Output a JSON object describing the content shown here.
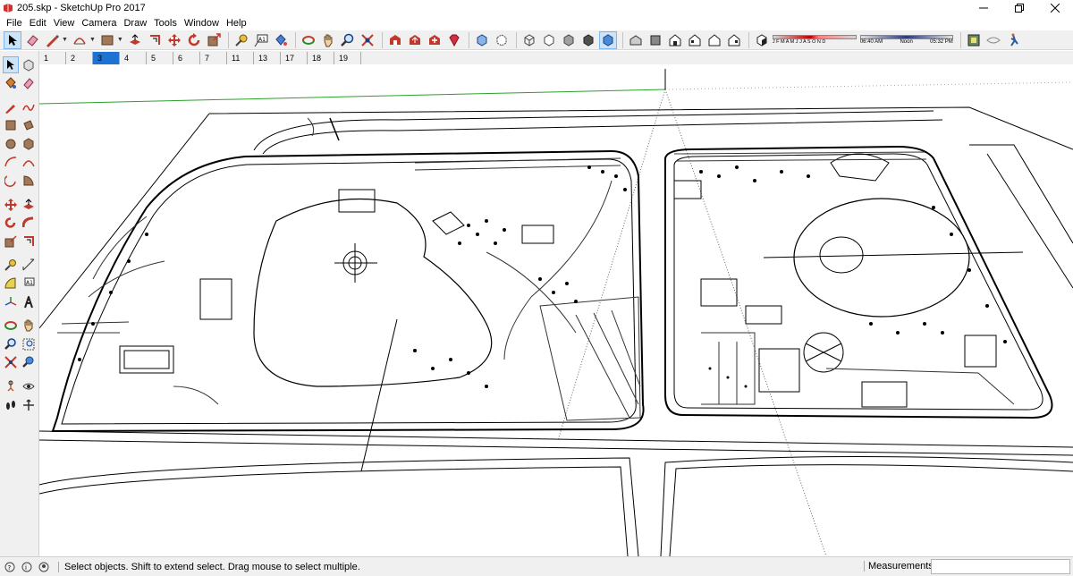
{
  "window": {
    "title": "205.skp - SketchUp Pro 2017",
    "controls": [
      "minimize",
      "maximize",
      "close"
    ]
  },
  "menu": [
    "File",
    "Edit",
    "View",
    "Camera",
    "Draw",
    "Tools",
    "Window",
    "Help"
  ],
  "shadow_settings": {
    "months": "J F M A M J J A S O N D",
    "time_start": "06:40 AM",
    "time_mid": "Noon",
    "time_end": "05:32 PM"
  },
  "scenes": {
    "tabs": [
      "1",
      "2",
      "3",
      "4",
      "5",
      "6",
      "7",
      "11",
      "13",
      "17",
      "18",
      "19"
    ],
    "active_index": 2
  },
  "status": {
    "message": "Select objects. Shift to extend select. Drag mouse to select multiple.",
    "measurements_label": "Measurements",
    "measurements_value": ""
  },
  "colors": {
    "accent": "#1e73d2",
    "green_axis": "#2ca02c",
    "red_icon": "#c0392b"
  }
}
